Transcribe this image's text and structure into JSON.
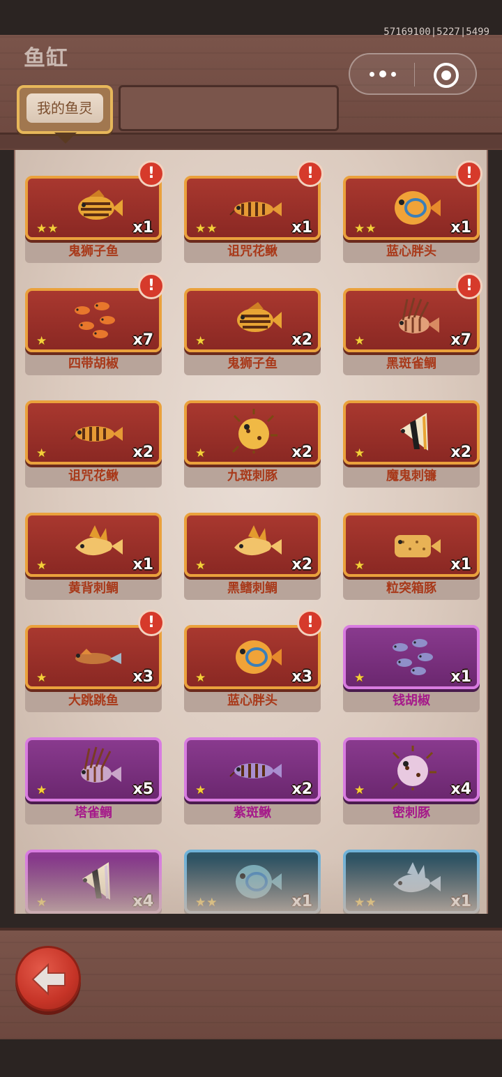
{
  "header": {
    "title": "鱼缸",
    "debug_text": "57169100|5227|5499",
    "tab_label": "我的鱼灵"
  },
  "colors": {
    "red_card": "#9b3129",
    "purple_card": "#7b2f80",
    "blue_card": "#2a4b5a",
    "name_red": "#a8391a",
    "name_purple": "#a5198a"
  },
  "fish": [
    {
      "name": "鬼狮子鱼",
      "count": "x1",
      "stars": "★★",
      "rarity": "red",
      "alert": "!",
      "icon": "striped-fish-icon"
    },
    {
      "name": "诅咒花鳅",
      "count": "x1",
      "stars": "★★",
      "rarity": "red",
      "alert": "!",
      "icon": "loach-icon"
    },
    {
      "name": "蓝心胖头",
      "count": "x1",
      "stars": "★★",
      "rarity": "red",
      "alert": "!",
      "icon": "round-fish-icon"
    },
    {
      "name": "四带胡椒",
      "count": "x7",
      "stars": "★",
      "rarity": "red",
      "alert": "!",
      "icon": "fish-school-icon"
    },
    {
      "name": "鬼狮子鱼",
      "count": "x2",
      "stars": "★",
      "rarity": "red",
      "alert": "",
      "icon": "striped-fish-icon"
    },
    {
      "name": "黑斑雀鲷",
      "count": "x7",
      "stars": "★",
      "rarity": "red",
      "alert": "!",
      "icon": "lionfish-icon"
    },
    {
      "name": "诅咒花鳅",
      "count": "x2",
      "stars": "★",
      "rarity": "red",
      "alert": "",
      "icon": "loach-icon"
    },
    {
      "name": "九斑刺豚",
      "count": "x2",
      "stars": "★",
      "rarity": "red",
      "alert": "",
      "icon": "pufferfish-icon"
    },
    {
      "name": "魔鬼刺镰",
      "count": "x2",
      "stars": "★",
      "rarity": "red",
      "alert": "",
      "icon": "moorish-idol-icon"
    },
    {
      "name": "黄背刺鲷",
      "count": "x1",
      "stars": "★",
      "rarity": "red",
      "alert": "",
      "icon": "bream-icon"
    },
    {
      "name": "黑鳍刺鲷",
      "count": "x2",
      "stars": "★",
      "rarity": "red",
      "alert": "",
      "icon": "bream-icon"
    },
    {
      "name": "粒突箱豚",
      "count": "x1",
      "stars": "★",
      "rarity": "red",
      "alert": "",
      "icon": "boxfish-icon"
    },
    {
      "name": "大跳跳鱼",
      "count": "x3",
      "stars": "★",
      "rarity": "red",
      "alert": "!",
      "icon": "mudskipper-icon"
    },
    {
      "name": "蓝心胖头",
      "count": "x3",
      "stars": "★",
      "rarity": "red",
      "alert": "!",
      "icon": "round-fish-icon"
    },
    {
      "name": "钱胡椒",
      "count": "x1",
      "stars": "★",
      "rarity": "purple",
      "alert": "",
      "icon": "fish-school-icon"
    },
    {
      "name": "塔雀鲷",
      "count": "x5",
      "stars": "★",
      "rarity": "purple",
      "alert": "",
      "icon": "lionfish-icon"
    },
    {
      "name": "紫斑鳅",
      "count": "x2",
      "stars": "★",
      "rarity": "purple",
      "alert": "",
      "icon": "loach-icon"
    },
    {
      "name": "密刺豚",
      "count": "x4",
      "stars": "★",
      "rarity": "purple",
      "alert": "",
      "icon": "pufferfish-icon"
    },
    {
      "name": "",
      "count": "x4",
      "stars": "★",
      "rarity": "purple",
      "alert": "",
      "icon": "moorish-idol-icon"
    },
    {
      "name": "",
      "count": "x1",
      "stars": "★★",
      "rarity": "blue",
      "alert": "",
      "icon": "round-fish-icon"
    },
    {
      "name": "",
      "count": "x1",
      "stars": "★★",
      "rarity": "blue",
      "alert": "",
      "icon": "bream-icon"
    }
  ]
}
